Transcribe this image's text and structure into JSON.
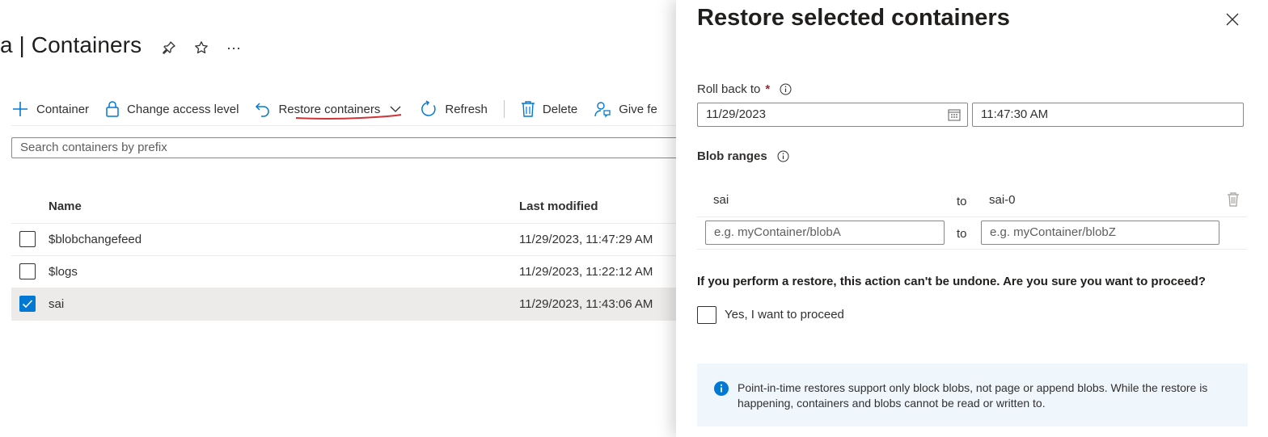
{
  "page": {
    "title": "a | Containers",
    "title_actions": [
      {
        "name": "pin-icon",
        "glyph": "📌"
      },
      {
        "name": "star-icon",
        "glyph": "☆"
      },
      {
        "name": "more-icon",
        "glyph": "···"
      }
    ]
  },
  "toolbar": {
    "container_label": "Container",
    "change_access_label": "Change access level",
    "restore_label": "Restore containers",
    "refresh_label": "Refresh",
    "delete_label": "Delete",
    "give_feedback_label": "Give fe"
  },
  "search": {
    "placeholder": "Search containers by prefix"
  },
  "table": {
    "columns": [
      "Name",
      "Last modified"
    ],
    "rows": [
      {
        "name": "$blobchangefeed",
        "last_modified": "11/29/2023, 11:47:29 AM",
        "selected": false
      },
      {
        "name": "$logs",
        "last_modified": "11/29/2023, 11:22:12 AM",
        "selected": false
      },
      {
        "name": "sai",
        "last_modified": "11/29/2023, 11:43:06 AM",
        "selected": true
      }
    ]
  },
  "panel": {
    "title": "Restore selected containers",
    "roll_back_label": "Roll back to",
    "required_marker": "*",
    "date_value": "11/29/2023",
    "time_value": "11:47:30 AM",
    "blob_ranges_label": "Blob ranges",
    "ranges": [
      {
        "from": "sai",
        "to_word": "to",
        "to": "sai-0"
      }
    ],
    "new_range": {
      "from_placeholder": "e.g. myContainer/blobA",
      "to_word": "to",
      "to_placeholder": "e.g. myContainer/blobZ"
    },
    "warning": "If you perform a restore, this action can't be undone. Are you sure you want to proceed?",
    "proceed_label": "Yes, I want to proceed",
    "info_text": "Point-in-time restores support only block blobs, not page or append blobs. While the restore is happening, containers and blobs cannot be read or written to."
  },
  "colors": {
    "accent": "#0078d4",
    "selected_row": "#edebe9",
    "required": "#a4262c",
    "info_background": "#eff6fc",
    "annotation": "#d13438"
  }
}
